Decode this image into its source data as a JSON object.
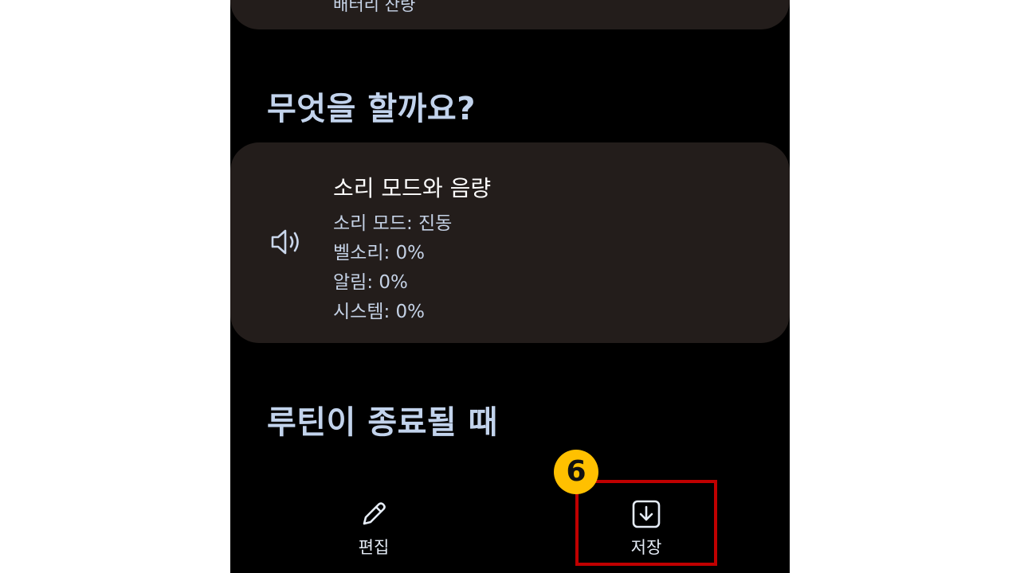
{
  "top_card": {
    "partial_text": "배터리 잔량"
  },
  "sections": {
    "what_to_do": "무엇을 할까요?",
    "when_ends": "루틴이 종료될 때"
  },
  "action_card": {
    "icon": "volume-icon",
    "title": "소리 모드와 음량",
    "lines": [
      "소리 모드: 진동",
      "벨소리: 0%",
      "알림: 0%",
      "시스템: 0%"
    ]
  },
  "bottom_bar": {
    "edit": {
      "label": "편집",
      "icon": "pencil-icon"
    },
    "save": {
      "label": "저장",
      "icon": "save-download-icon"
    }
  },
  "annotation": {
    "step_number": "6",
    "highlight_color": "#c00000",
    "badge_color": "#ffc000"
  }
}
